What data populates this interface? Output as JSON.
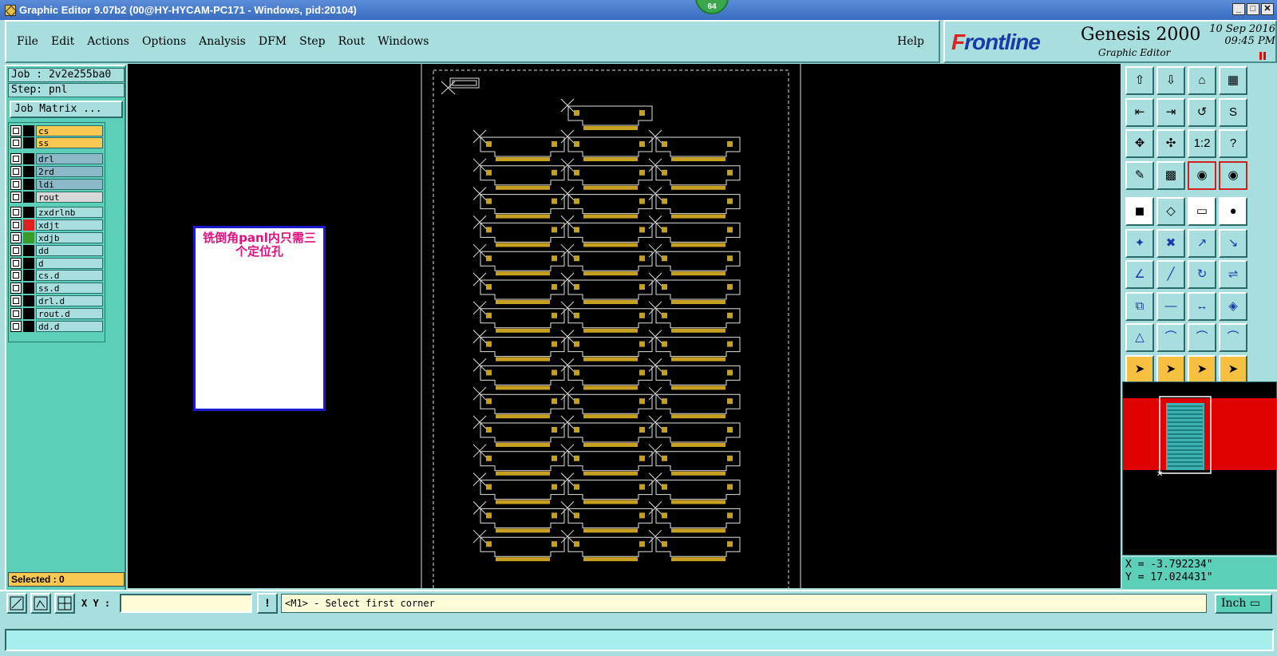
{
  "window": {
    "title": "Graphic Editor 9.07b2 (00@HY-HYCAM-PC171 - Windows, pid:20104)",
    "badge": "64"
  },
  "menu": {
    "items": [
      "File",
      "Edit",
      "Actions",
      "Options",
      "Analysis",
      "DFM",
      "Step",
      "Rout",
      "Windows"
    ],
    "help": "Help"
  },
  "logo": {
    "brand_a": "F",
    "brand_b": "rontline",
    "product": "Genesis 2000",
    "subtitle": "Graphic Editor",
    "date": "10 Sep 2016",
    "time": "09:45 PM"
  },
  "job": {
    "job_label": "Job : 2v2e255ba0",
    "step_label": "Step: pnl",
    "matrix_button": "Job Matrix ..."
  },
  "layers": [
    {
      "name": "cs",
      "color": "#f8c850",
      "swatch": "#000"
    },
    {
      "name": "ss",
      "color": "#f8c850",
      "swatch": "#000"
    },
    {
      "name": "drl",
      "color": "#8cb8c8",
      "swatch": "#000"
    },
    {
      "name": "2rd",
      "color": "#8cb8c8",
      "swatch": "#000"
    },
    {
      "name": "ldi",
      "color": "#8cb8c8",
      "swatch": "#000"
    },
    {
      "name": "rout",
      "color": "#d8d8d8",
      "swatch": "#000"
    },
    {
      "name": "zxdrlnb",
      "color": "#a8dede",
      "swatch": "#000"
    },
    {
      "name": "xdjt",
      "color": "#a8dede",
      "swatch": "#e02020"
    },
    {
      "name": "xdjb",
      "color": "#a8dede",
      "swatch": "#3a9a2a"
    },
    {
      "name": "dd",
      "color": "#a8dede",
      "swatch": "#000"
    },
    {
      "name": "d",
      "color": "#a8dede",
      "swatch": "#000"
    },
    {
      "name": "cs.d",
      "color": "#a8dede",
      "swatch": "#000"
    },
    {
      "name": "ss.d",
      "color": "#a8dede",
      "swatch": "#000"
    },
    {
      "name": "drl.d",
      "color": "#a8dede",
      "swatch": "#000"
    },
    {
      "name": "rout.d",
      "color": "#a8dede",
      "swatch": "#000"
    },
    {
      "name": "dd.d",
      "color": "#a8dede",
      "swatch": "#000"
    }
  ],
  "selected": "Selected : 0",
  "note": {
    "text": "铣倒角panl内只需三个定位孔"
  },
  "coords": {
    "x": "X = -3.792234\"",
    "y": "Y = 17.024431\""
  },
  "bottom": {
    "xy_label": "X Y :",
    "xy_value": "",
    "exclam": "!",
    "prompt": "<M1> - Select first corner",
    "units": "Inch"
  },
  "colors": {
    "pcb_gold": "#c8a020",
    "outline": "#e0e0e0",
    "mini_red": "#e00000",
    "mini_cyan": "#20d0d0"
  }
}
